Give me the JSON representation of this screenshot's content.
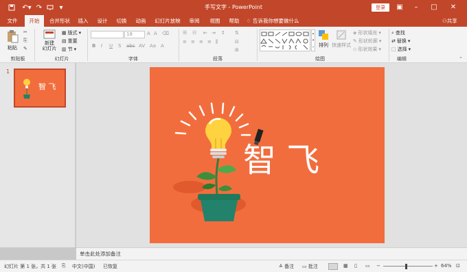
{
  "titlebar": {
    "title": "手写文字 - PowerPoint",
    "login_label": "登录",
    "icons": [
      "save-icon",
      "undo-icon",
      "redo-icon",
      "presenter-icon",
      "customize-icon"
    ]
  },
  "tabs": [
    {
      "label": "文件"
    },
    {
      "label": "开始",
      "active": true
    },
    {
      "label": "合并形状"
    },
    {
      "label": "插入"
    },
    {
      "label": "设计"
    },
    {
      "label": "切换"
    },
    {
      "label": "动画"
    },
    {
      "label": "幻灯片放映"
    },
    {
      "label": "审阅"
    },
    {
      "label": "视图"
    },
    {
      "label": "帮助"
    }
  ],
  "tellme": "告诉我你想要做什么",
  "share_label": "共享",
  "ribbon": {
    "clipboard": {
      "paste": "粘贴",
      "label": "剪贴板"
    },
    "slides": {
      "new_slide": "新建\n幻灯片",
      "layout": "版式",
      "reset": "重置",
      "section": "节",
      "label": "幻灯片"
    },
    "font": {
      "font_name": "",
      "font_size": "18",
      "label": "字体"
    },
    "paragraph": {
      "label": "段落"
    },
    "drawing": {
      "arrange": "排列",
      "quick_styles": "快速样式",
      "shape_fill": "形状填充",
      "shape_outline": "形状轮廓",
      "shape_effects": "形状效果",
      "label": "绘图"
    },
    "editing": {
      "find": "查找",
      "replace": "替换",
      "select": "选择",
      "label": "编辑"
    }
  },
  "thumbnails": [
    {
      "number": "1"
    }
  ],
  "slide": {
    "text": "智 飞"
  },
  "notes_placeholder": "单击此处添加备注",
  "status": {
    "slide_info": "幻灯片 第 1 张，共 1 张",
    "language": "中文(中国)",
    "recovered": "已恢复",
    "notes": "备注",
    "comments": "批注",
    "zoom": "64%"
  },
  "colors": {
    "accent": "#c24629",
    "slide_bg": "#f26d3d"
  }
}
